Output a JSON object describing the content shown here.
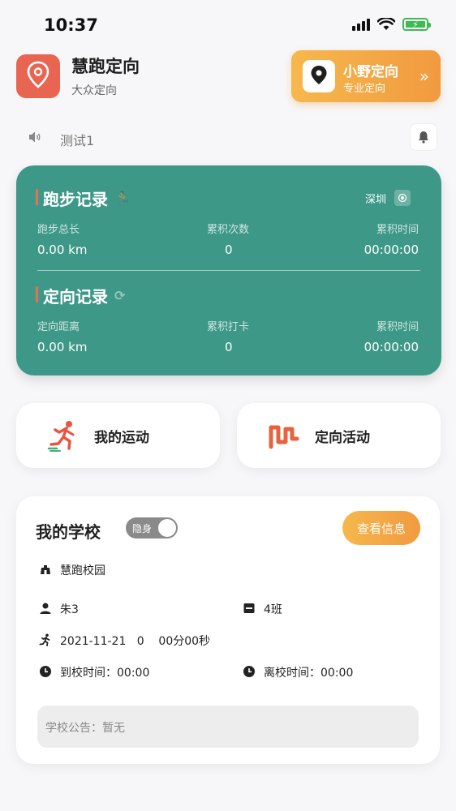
{
  "status_bar": {
    "time": "10:37",
    "battery_icon": "charging-battery-icon",
    "wifi_icon": "wifi-icon",
    "signal_icon": "cellular-signal-icon"
  },
  "header": {
    "app_title": "慧跑定向",
    "app_subtitle": "大众定向",
    "pro_banner": {
      "title": "小野定向",
      "subtitle": "专业定向",
      "arrow": "»"
    }
  },
  "announcement": {
    "text": "测试1"
  },
  "running_record": {
    "title": "跑步记录",
    "city": "深圳",
    "stats": [
      {
        "label": "跑步总长",
        "value": "0.00 km"
      },
      {
        "label": "累积次数",
        "value": "0"
      },
      {
        "label": "累积时间",
        "value": "00:00:00"
      }
    ]
  },
  "orienteering_record": {
    "title": "定向记录",
    "stats": [
      {
        "label": "定向距离",
        "value": "0.00 km"
      },
      {
        "label": "累积打卡",
        "value": "0"
      },
      {
        "label": "累积时间",
        "value": "00:00:00"
      }
    ]
  },
  "actions": {
    "my_sport": "我的运动",
    "orienteering_activity": "定向活动"
  },
  "school": {
    "title": "我的学校",
    "toggle_label": "隐身",
    "info_button": "查看信息",
    "campus": "慧跑校园",
    "student": "朱3",
    "class": "4班",
    "activity": "2021-11-21   0    00分00秒",
    "arrive_time": "到校时间：00:00",
    "leave_time": "离校时间：00:00",
    "notice": "学校公告：暂无"
  },
  "colors": {
    "record_card": "#3e9887",
    "accent_orange": "#f19a3f",
    "logo_red": "#e86552"
  }
}
